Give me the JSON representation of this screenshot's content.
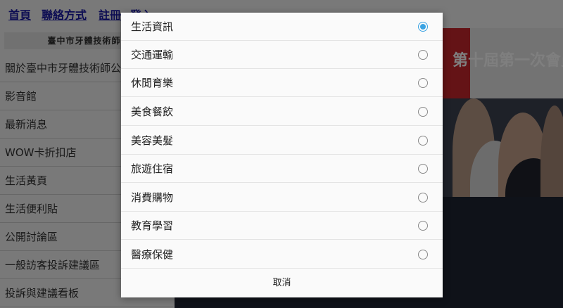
{
  "topnav": [
    "首頁",
    "聯絡方式",
    "註冊",
    "登入"
  ],
  "sidebar": {
    "header": "臺中市牙體技術師公",
    "items": [
      "關於臺中市牙體技術師公",
      "影音館",
      "最新消息",
      "WOW卡折扣店",
      "生活黃頁",
      "生活便利貼",
      "公開討論區",
      "一般訪客投訴建議區",
      "投訴與建議看板"
    ]
  },
  "photo": {
    "banner_text": "第十屆第一次會員大會"
  },
  "dialog": {
    "options": [
      {
        "label": "生活資訊",
        "selected": true
      },
      {
        "label": "交通運輸",
        "selected": false
      },
      {
        "label": "休閒育樂",
        "selected": false
      },
      {
        "label": "美食餐飲",
        "selected": false
      },
      {
        "label": "美容美髮",
        "selected": false
      },
      {
        "label": "旅遊住宿",
        "selected": false
      },
      {
        "label": "消費購物",
        "selected": false
      },
      {
        "label": "教育學習",
        "selected": false
      },
      {
        "label": "醫療保健",
        "selected": false
      }
    ],
    "cancel_label": "取消"
  },
  "colors": {
    "radio_selected": "#3aa3e3",
    "link": "#1a1aa6",
    "banner": "#c8262c"
  }
}
